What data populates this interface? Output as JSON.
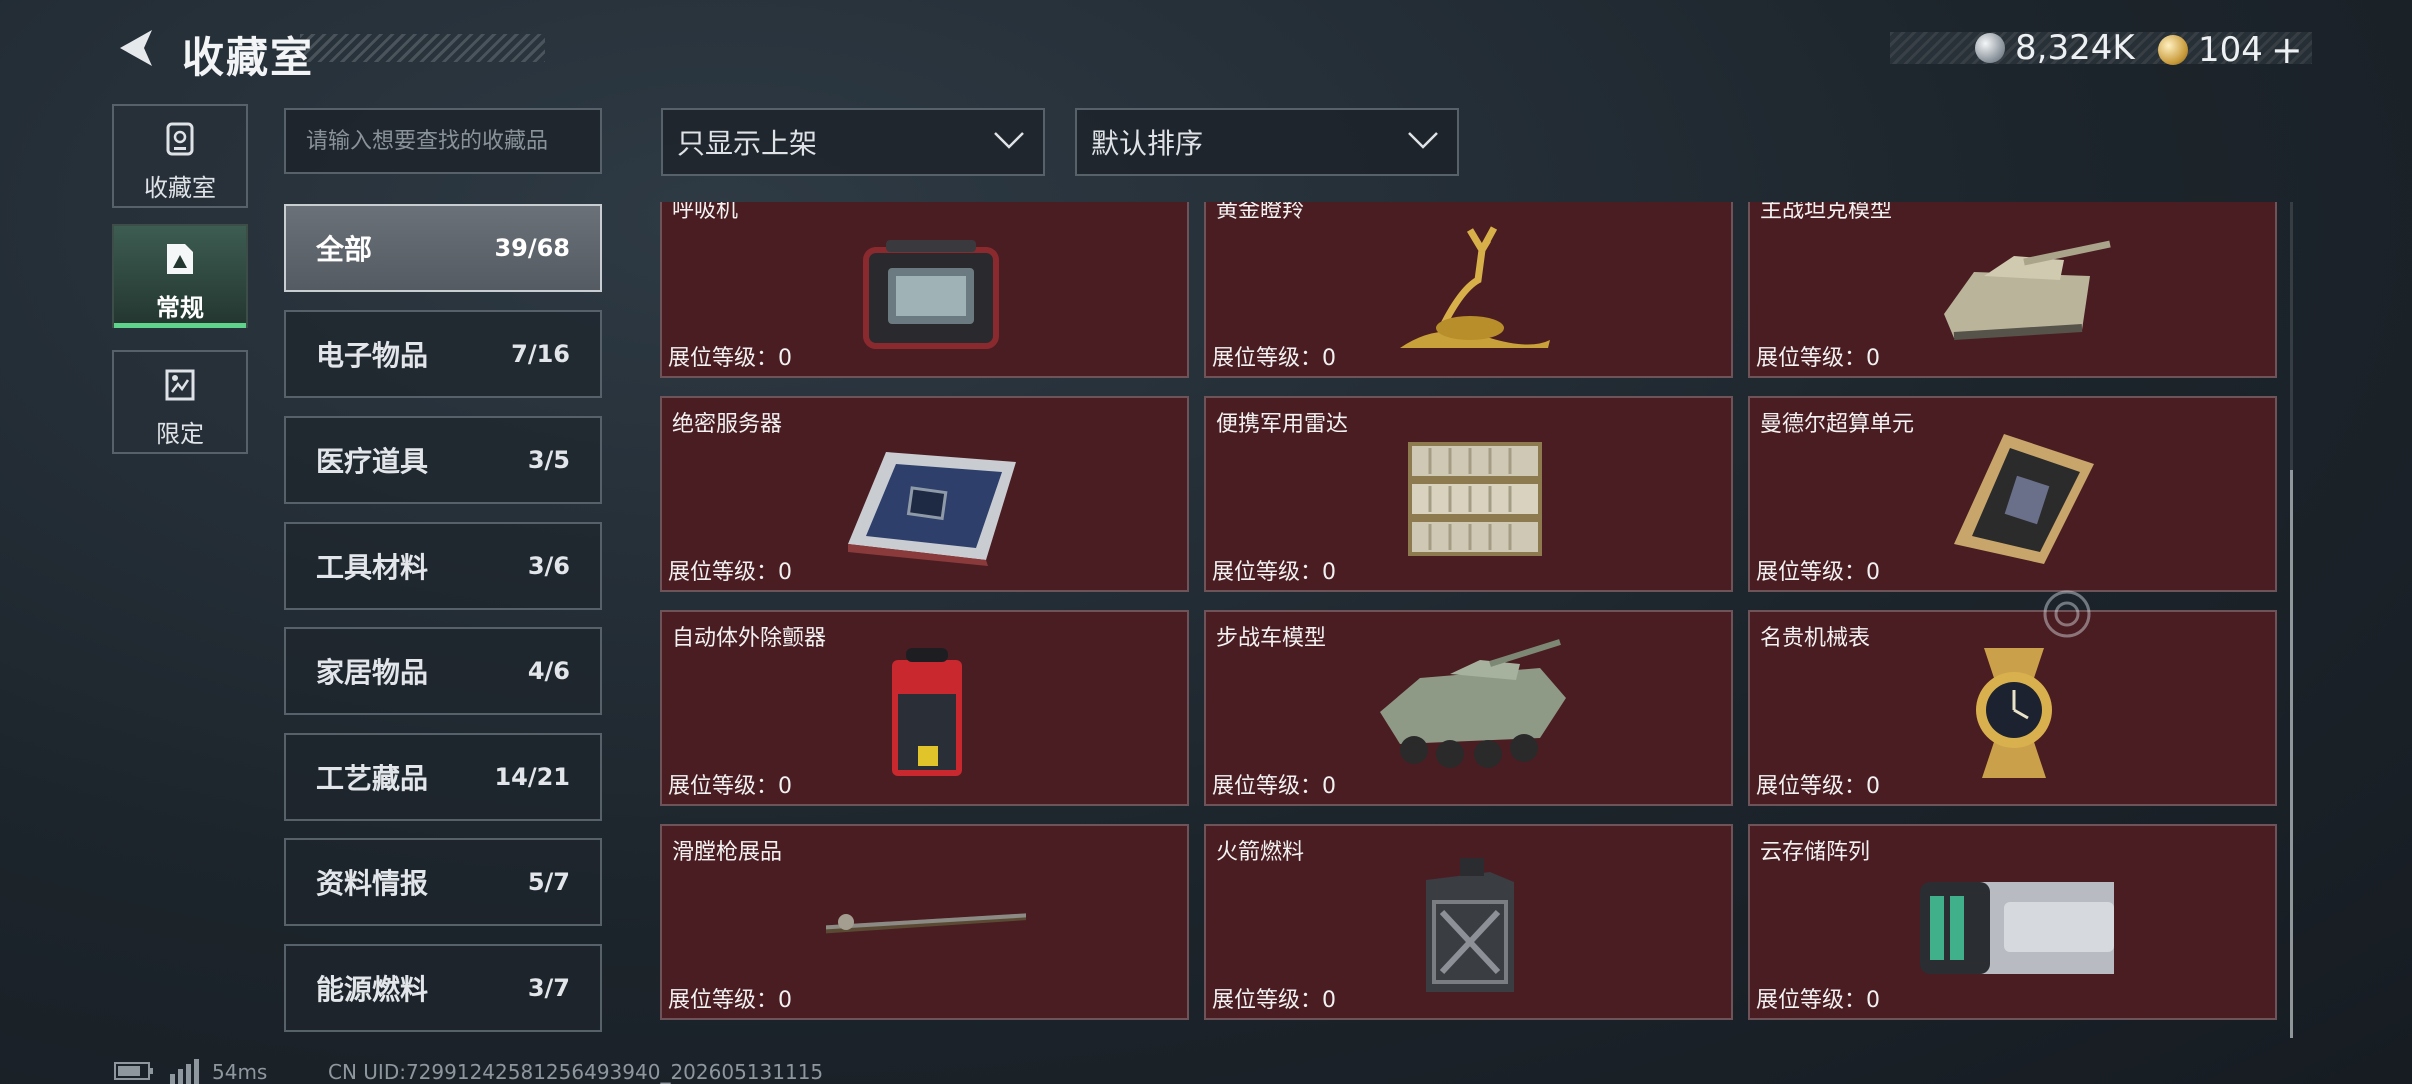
{
  "header": {
    "title": "收藏室",
    "currency_silver": "8,324K",
    "currency_gold": "104",
    "add_symbol": "+"
  },
  "nav": [
    {
      "label": "收藏室",
      "icon": "collection-room-icon"
    },
    {
      "label": "常规",
      "icon": "regular-icon",
      "active": true
    },
    {
      "label": "限定",
      "icon": "limited-icon"
    }
  ],
  "search": {
    "placeholder": "请输入想要查找的收藏品"
  },
  "filters": {
    "display": "只显示上架",
    "sort": "默认排序"
  },
  "categories": [
    {
      "name": "全部",
      "count": "39/68",
      "active": true
    },
    {
      "name": "电子物品",
      "count": "7/16"
    },
    {
      "name": "医疗道具",
      "count": "3/5"
    },
    {
      "name": "工具材料",
      "count": "3/6"
    },
    {
      "name": "家居物品",
      "count": "4/6"
    },
    {
      "name": "工艺藏品",
      "count": "14/21"
    },
    {
      "name": "资料情报",
      "count": "5/7"
    },
    {
      "name": "能源燃料",
      "count": "3/7"
    }
  ],
  "level_label": "展位等级：0",
  "items": [
    {
      "name": "呼吸机"
    },
    {
      "name": "黄金瞪羚"
    },
    {
      "name": "主战坦克模型"
    },
    {
      "name": "绝密服务器"
    },
    {
      "name": "便携军用雷达"
    },
    {
      "name": "曼德尔超算单元"
    },
    {
      "name": "自动体外除颤器"
    },
    {
      "name": "步战车模型"
    },
    {
      "name": "名贵机械表"
    },
    {
      "name": "滑膛枪展品"
    },
    {
      "name": "火箭燃料"
    },
    {
      "name": "云存储阵列"
    }
  ],
  "status": {
    "ping": "54ms",
    "uid": "CN UID:7299124258125649394​0_202605131115"
  },
  "colors": {
    "card_bg": "#4a1d22",
    "active_accent": "#5fd38c"
  }
}
